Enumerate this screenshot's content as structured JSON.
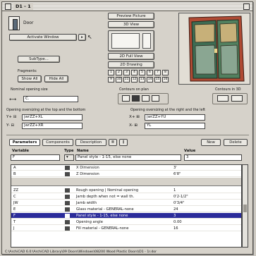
{
  "window": {
    "title": "D1 - 1"
  },
  "header": {
    "object_name": "Door",
    "activate_window": "Activate Window",
    "subtype": "SubType...",
    "fragments_label": "Fragments:",
    "show_all": "Show All",
    "hide_all": "Hide All",
    "fragment_rows": [
      [
        "1",
        "2",
        "3",
        "4",
        "5",
        "6",
        "7",
        "8"
      ],
      [
        "9",
        "10",
        "11",
        "12",
        "13",
        "14",
        "15",
        "16"
      ]
    ]
  },
  "view_buttons": {
    "preview_picture": "Preview Picture",
    "view_3d": "3D View",
    "full_view_2d": "2D Full View",
    "drawing_2d": "2D Drawing"
  },
  "size": {
    "nominal_label": "Nominal opening size",
    "width_value": "C.",
    "contours_plan": "Contours on plan",
    "contours_3d": "Contours in 3D",
    "oversize_top_label": "Opening oversizing at the top and the bottom",
    "oversize_side_label": "Opening oversizing at the right and the left",
    "top_field": "jwrZZ+XL",
    "bottom_field": "jwrZZ+XR",
    "right_field": "jwrZZ+YU",
    "left_field": "YL"
  },
  "tabs": {
    "parameters": "Parameters",
    "components": "Components",
    "description": "Description",
    "new": "New",
    "delete": "Delete"
  },
  "columns": {
    "variable": "Variable",
    "type": "Type",
    "name": "Name",
    "value": "Value"
  },
  "edit_row": {
    "variable": "F",
    "name": "Panel style - 1-15, else none",
    "value": "3"
  },
  "rows_top": [
    {
      "var": "A",
      "name": "X Dimension",
      "value": "3'"
    },
    {
      "var": "B",
      "name": "Z Dimension",
      "value": "6'8\""
    }
  ],
  "rows_bottom": [
    {
      "var": "ZZ",
      "name": "Rough opening | Nominal opening",
      "value": "1"
    },
    {
      "var": "C",
      "name": "Jamb depth when not = wall th.",
      "value": "0'2-1/2\""
    },
    {
      "var": "JW",
      "name": "Jamb width",
      "value": "0'3/4\""
    },
    {
      "var": "E",
      "name": "Glass material - GENERAL-none",
      "value": "24"
    },
    {
      "var": "F",
      "name": "Panel style - 1-15, else none",
      "value": "3",
      "selected": true
    },
    {
      "var": "T",
      "name": "Opening angle",
      "value": "0.00"
    },
    {
      "var": "J",
      "name": "Fill material - GENERAL-none",
      "value": "16"
    }
  ],
  "status": {
    "path": "C:\\ArchiCAD 6.0:\\ArchiCAD Library\\09 Doors\\Windows\\08200 Wood Plastic Doors\\D1 - 1r.dor"
  },
  "colors": {
    "window_bg": "#d6d2ca",
    "selection": "#2b2c9a",
    "door_red": "#a6402e",
    "door_green": "#3f6d52"
  }
}
